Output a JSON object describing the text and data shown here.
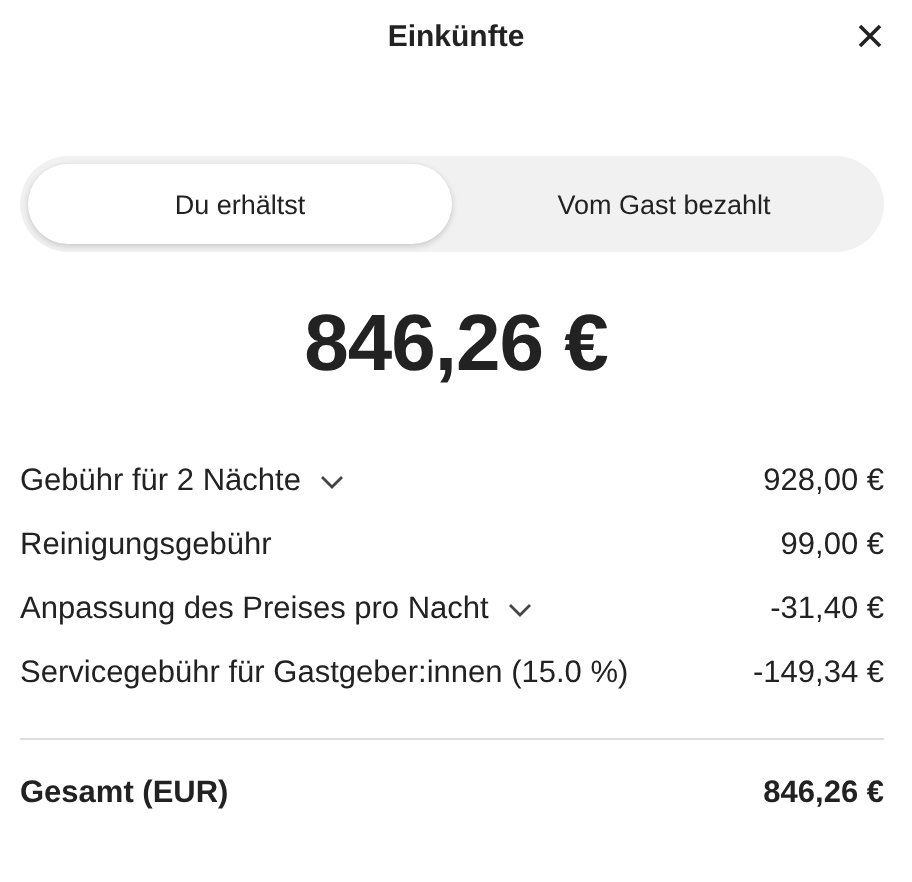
{
  "header": {
    "title": "Einkünfte"
  },
  "tabs": [
    {
      "label": "Du erhältst",
      "selected": true
    },
    {
      "label": "Vom Gast bezahlt",
      "selected": false
    }
  ],
  "amount": "846,26 €",
  "line_items": [
    {
      "label": "Gebühr für 2 Nächte",
      "value": "928,00 €",
      "expandable": true
    },
    {
      "label": "Reinigungsgebühr",
      "value": "99,00 €",
      "expandable": false
    },
    {
      "label": "Anpassung des Preises pro Nacht",
      "value": "-31,40 €",
      "expandable": true
    },
    {
      "label": "Servicegebühr für Gastgeber:innen (15.0 %)",
      "value": "-149,34 €",
      "expandable": false
    }
  ],
  "total": {
    "label": "Gesamt (EUR)",
    "value": "846,26 €"
  }
}
